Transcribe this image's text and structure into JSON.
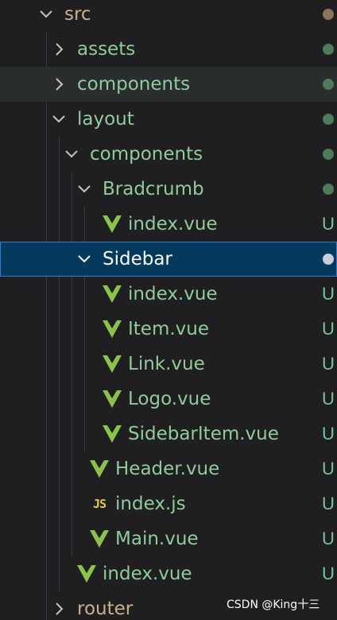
{
  "explorer": {
    "colors": {
      "background": "#1f1f22",
      "hover_row": "#2a2d2e",
      "selected_row": "#04395e",
      "selected_border": "#2f7fd0",
      "label_green": "#8fcc9a",
      "vue_icon": "#8bc34a",
      "js_icon": "#e8c64c",
      "untracked_badge": "#73c991"
    },
    "items": [
      {
        "label": "src",
        "type": "folder",
        "expanded": true,
        "depth": 0,
        "status": "dot",
        "dot_color": "brown",
        "label_color": "#c8b08c"
      },
      {
        "label": "assets",
        "type": "folder",
        "expanded": false,
        "depth": 1,
        "status": "dot",
        "dot_color": "green"
      },
      {
        "label": "components",
        "type": "folder",
        "expanded": false,
        "depth": 1,
        "status": "dot",
        "dot_color": "green",
        "hover": true
      },
      {
        "label": "layout",
        "type": "folder",
        "expanded": true,
        "depth": 1,
        "status": "dot",
        "dot_color": "green"
      },
      {
        "label": "components",
        "type": "folder",
        "expanded": true,
        "depth": 2,
        "status": "dot",
        "dot_color": "green"
      },
      {
        "label": "Bradcrumb",
        "type": "folder",
        "expanded": true,
        "depth": 3,
        "status": "dot",
        "dot_color": "green"
      },
      {
        "label": "index.vue",
        "type": "vue",
        "depth": 4,
        "status": "U"
      },
      {
        "label": "Sidebar",
        "type": "folder",
        "expanded": true,
        "depth": 3,
        "status": "dot",
        "dot_color": "white",
        "selected": true
      },
      {
        "label": "index.vue",
        "type": "vue",
        "depth": 4,
        "status": "U"
      },
      {
        "label": "Item.vue",
        "type": "vue",
        "depth": 4,
        "status": "U"
      },
      {
        "label": "Link.vue",
        "type": "vue",
        "depth": 4,
        "status": "U"
      },
      {
        "label": "Logo.vue",
        "type": "vue",
        "depth": 4,
        "status": "U"
      },
      {
        "label": "SidebarItem.vue",
        "type": "vue",
        "depth": 4,
        "status": "U"
      },
      {
        "label": "Header.vue",
        "type": "vue",
        "depth": 3,
        "status": "U"
      },
      {
        "label": "index.js",
        "type": "js",
        "icon_text": "JS",
        "depth": 3,
        "status": "U"
      },
      {
        "label": "Main.vue",
        "type": "vue",
        "depth": 3,
        "status": "U"
      },
      {
        "label": "index.vue",
        "type": "vue",
        "depth": 2,
        "status": "U"
      },
      {
        "label": "router",
        "type": "folder",
        "expanded": false,
        "depth": 1,
        "status": "none",
        "label_color": "#c8b08c"
      }
    ]
  },
  "watermark": "CSDN @King十三"
}
